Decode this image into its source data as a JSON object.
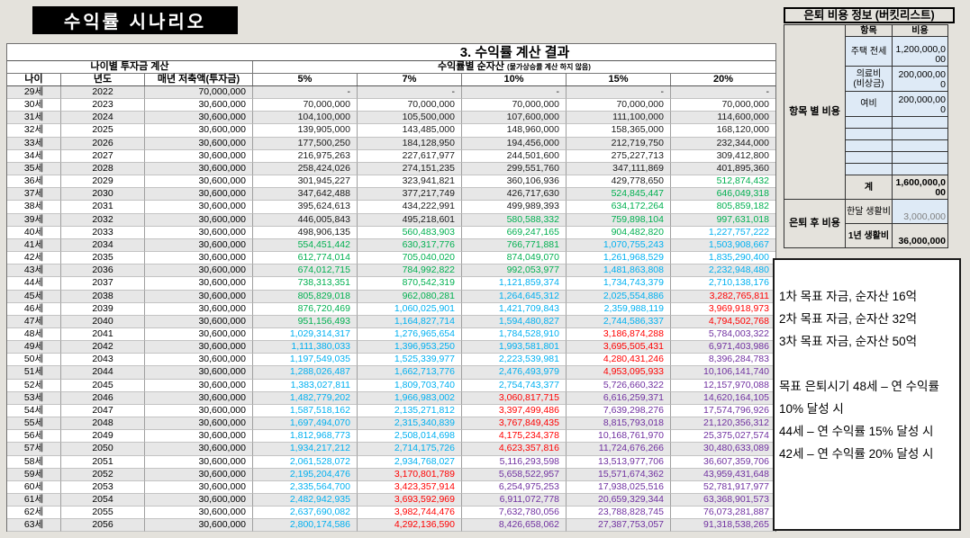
{
  "page_title": "수익률 시나리오",
  "colors": {
    "page_bg": "#E4E2DC",
    "title_bg": "#000000",
    "title_fg": "#FFFFFF",
    "stripe": "#E7E7E7",
    "panel_blue": "#DEEAF6",
    "gray_value": "#808080",
    "k": "#1A1A1A",
    "g": "#00B050",
    "b": "#00B0F0",
    "r": "#FF0000",
    "p": "#7030A0"
  },
  "main_table": {
    "title": "3. 수익률 계산 결과",
    "left_group_header": "나이별 투자금 계산",
    "right_group_header": "수익률별 순자산",
    "right_group_note": "(물가상승률 계산 하지 않음)",
    "columns": [
      "나이",
      "년도",
      "매년 저축액(투자금)",
      "5%",
      "7%",
      "10%",
      "15%",
      "20%"
    ],
    "rows": [
      [
        "29세",
        "2022",
        "70,000,000",
        [
          "-",
          "k"
        ],
        [
          "-",
          "k"
        ],
        [
          "-",
          "k"
        ],
        [
          "-",
          "k"
        ],
        [
          "-",
          "k"
        ]
      ],
      [
        "30세",
        "2023",
        "30,600,000",
        [
          "70,000,000",
          "k"
        ],
        [
          "70,000,000",
          "k"
        ],
        [
          "70,000,000",
          "k"
        ],
        [
          "70,000,000",
          "k"
        ],
        [
          "70,000,000",
          "k"
        ]
      ],
      [
        "31세",
        "2024",
        "30,600,000",
        [
          "104,100,000",
          "k"
        ],
        [
          "105,500,000",
          "k"
        ],
        [
          "107,600,000",
          "k"
        ],
        [
          "111,100,000",
          "k"
        ],
        [
          "114,600,000",
          "k"
        ]
      ],
      [
        "32세",
        "2025",
        "30,600,000",
        [
          "139,905,000",
          "k"
        ],
        [
          "143,485,000",
          "k"
        ],
        [
          "148,960,000",
          "k"
        ],
        [
          "158,365,000",
          "k"
        ],
        [
          "168,120,000",
          "k"
        ]
      ],
      [
        "33세",
        "2026",
        "30,600,000",
        [
          "177,500,250",
          "k"
        ],
        [
          "184,128,950",
          "k"
        ],
        [
          "194,456,000",
          "k"
        ],
        [
          "212,719,750",
          "k"
        ],
        [
          "232,344,000",
          "k"
        ]
      ],
      [
        "34세",
        "2027",
        "30,600,000",
        [
          "216,975,263",
          "k"
        ],
        [
          "227,617,977",
          "k"
        ],
        [
          "244,501,600",
          "k"
        ],
        [
          "275,227,713",
          "k"
        ],
        [
          "309,412,800",
          "k"
        ]
      ],
      [
        "35세",
        "2028",
        "30,600,000",
        [
          "258,424,026",
          "k"
        ],
        [
          "274,151,235",
          "k"
        ],
        [
          "299,551,760",
          "k"
        ],
        [
          "347,111,869",
          "k"
        ],
        [
          "401,895,360",
          "k"
        ]
      ],
      [
        "36세",
        "2029",
        "30,600,000",
        [
          "301,945,227",
          "k"
        ],
        [
          "323,941,821",
          "k"
        ],
        [
          "360,106,936",
          "k"
        ],
        [
          "429,778,650",
          "k"
        ],
        [
          "512,874,432",
          "g"
        ]
      ],
      [
        "37세",
        "2030",
        "30,600,000",
        [
          "347,642,488",
          "k"
        ],
        [
          "377,217,749",
          "k"
        ],
        [
          "426,717,630",
          "k"
        ],
        [
          "524,845,447",
          "g"
        ],
        [
          "646,049,318",
          "g"
        ]
      ],
      [
        "38세",
        "2031",
        "30,600,000",
        [
          "395,624,613",
          "k"
        ],
        [
          "434,222,991",
          "k"
        ],
        [
          "499,989,393",
          "k"
        ],
        [
          "634,172,264",
          "g"
        ],
        [
          "805,859,182",
          "g"
        ]
      ],
      [
        "39세",
        "2032",
        "30,600,000",
        [
          "446,005,843",
          "k"
        ],
        [
          "495,218,601",
          "k"
        ],
        [
          "580,588,332",
          "g"
        ],
        [
          "759,898,104",
          "g"
        ],
        [
          "997,631,018",
          "g"
        ]
      ],
      [
        "40세",
        "2033",
        "30,600,000",
        [
          "498,906,135",
          "k"
        ],
        [
          "560,483,903",
          "g"
        ],
        [
          "669,247,165",
          "g"
        ],
        [
          "904,482,820",
          "g"
        ],
        [
          "1,227,757,222",
          "b"
        ]
      ],
      [
        "41세",
        "2034",
        "30,600,000",
        [
          "554,451,442",
          "g"
        ],
        [
          "630,317,776",
          "g"
        ],
        [
          "766,771,881",
          "g"
        ],
        [
          "1,070,755,243",
          "b"
        ],
        [
          "1,503,908,667",
          "b"
        ]
      ],
      [
        "42세",
        "2035",
        "30,600,000",
        [
          "612,774,014",
          "g"
        ],
        [
          "705,040,020",
          "g"
        ],
        [
          "874,049,070",
          "g"
        ],
        [
          "1,261,968,529",
          "b"
        ],
        [
          "1,835,290,400",
          "b"
        ]
      ],
      [
        "43세",
        "2036",
        "30,600,000",
        [
          "674,012,715",
          "g"
        ],
        [
          "784,992,822",
          "g"
        ],
        [
          "992,053,977",
          "g"
        ],
        [
          "1,481,863,808",
          "b"
        ],
        [
          "2,232,948,480",
          "b"
        ]
      ],
      [
        "44세",
        "2037",
        "30,600,000",
        [
          "738,313,351",
          "g"
        ],
        [
          "870,542,319",
          "g"
        ],
        [
          "1,121,859,374",
          "b"
        ],
        [
          "1,734,743,379",
          "b"
        ],
        [
          "2,710,138,176",
          "b"
        ]
      ],
      [
        "45세",
        "2038",
        "30,600,000",
        [
          "805,829,018",
          "g"
        ],
        [
          "962,080,281",
          "g"
        ],
        [
          "1,264,645,312",
          "b"
        ],
        [
          "2,025,554,886",
          "b"
        ],
        [
          "3,282,765,811",
          "r"
        ]
      ],
      [
        "46세",
        "2039",
        "30,600,000",
        [
          "876,720,469",
          "g"
        ],
        [
          "1,060,025,901",
          "b"
        ],
        [
          "1,421,709,843",
          "b"
        ],
        [
          "2,359,988,119",
          "b"
        ],
        [
          "3,969,918,973",
          "r"
        ]
      ],
      [
        "47세",
        "2040",
        "30,600,000",
        [
          "951,156,493",
          "g"
        ],
        [
          "1,164,827,714",
          "b"
        ],
        [
          "1,594,480,827",
          "b"
        ],
        [
          "2,744,586,337",
          "b"
        ],
        [
          "4,794,502,768",
          "r"
        ]
      ],
      [
        "48세",
        "2041",
        "30,600,000",
        [
          "1,029,314,317",
          "b"
        ],
        [
          "1,276,965,654",
          "b"
        ],
        [
          "1,784,528,910",
          "b"
        ],
        [
          "3,186,874,288",
          "r"
        ],
        [
          "5,784,003,322",
          "p"
        ]
      ],
      [
        "49세",
        "2042",
        "30,600,000",
        [
          "1,111,380,033",
          "b"
        ],
        [
          "1,396,953,250",
          "b"
        ],
        [
          "1,993,581,801",
          "b"
        ],
        [
          "3,695,505,431",
          "r"
        ],
        [
          "6,971,403,986",
          "p"
        ]
      ],
      [
        "50세",
        "2043",
        "30,600,000",
        [
          "1,197,549,035",
          "b"
        ],
        [
          "1,525,339,977",
          "b"
        ],
        [
          "2,223,539,981",
          "b"
        ],
        [
          "4,280,431,246",
          "r"
        ],
        [
          "8,396,284,783",
          "p"
        ]
      ],
      [
        "51세",
        "2044",
        "30,600,000",
        [
          "1,288,026,487",
          "b"
        ],
        [
          "1,662,713,776",
          "b"
        ],
        [
          "2,476,493,979",
          "b"
        ],
        [
          "4,953,095,933",
          "r"
        ],
        [
          "10,106,141,740",
          "p"
        ]
      ],
      [
        "52세",
        "2045",
        "30,600,000",
        [
          "1,383,027,811",
          "b"
        ],
        [
          "1,809,703,740",
          "b"
        ],
        [
          "2,754,743,377",
          "b"
        ],
        [
          "5,726,660,322",
          "p"
        ],
        [
          "12,157,970,088",
          "p"
        ]
      ],
      [
        "53세",
        "2046",
        "30,600,000",
        [
          "1,482,779,202",
          "b"
        ],
        [
          "1,966,983,002",
          "b"
        ],
        [
          "3,060,817,715",
          "r"
        ],
        [
          "6,616,259,371",
          "p"
        ],
        [
          "14,620,164,105",
          "p"
        ]
      ],
      [
        "54세",
        "2047",
        "30,600,000",
        [
          "1,587,518,162",
          "b"
        ],
        [
          "2,135,271,812",
          "b"
        ],
        [
          "3,397,499,486",
          "r"
        ],
        [
          "7,639,298,276",
          "p"
        ],
        [
          "17,574,796,926",
          "p"
        ]
      ],
      [
        "55세",
        "2048",
        "30,600,000",
        [
          "1,697,494,070",
          "b"
        ],
        [
          "2,315,340,839",
          "b"
        ],
        [
          "3,767,849,435",
          "r"
        ],
        [
          "8,815,793,018",
          "p"
        ],
        [
          "21,120,356,312",
          "p"
        ]
      ],
      [
        "56세",
        "2049",
        "30,600,000",
        [
          "1,812,968,773",
          "b"
        ],
        [
          "2,508,014,698",
          "b"
        ],
        [
          "4,175,234,378",
          "r"
        ],
        [
          "10,168,761,970",
          "p"
        ],
        [
          "25,375,027,574",
          "p"
        ]
      ],
      [
        "57세",
        "2050",
        "30,600,000",
        [
          "1,934,217,212",
          "b"
        ],
        [
          "2,714,175,726",
          "b"
        ],
        [
          "4,623,357,816",
          "r"
        ],
        [
          "11,724,676,266",
          "p"
        ],
        [
          "30,480,633,089",
          "p"
        ]
      ],
      [
        "58세",
        "2051",
        "30,600,000",
        [
          "2,061,528,072",
          "b"
        ],
        [
          "2,934,768,027",
          "b"
        ],
        [
          "5,116,293,598",
          "p"
        ],
        [
          "13,513,977,706",
          "p"
        ],
        [
          "36,607,359,706",
          "p"
        ]
      ],
      [
        "59세",
        "2052",
        "30,600,000",
        [
          "2,195,204,476",
          "b"
        ],
        [
          "3,170,801,789",
          "r"
        ],
        [
          "5,658,522,957",
          "p"
        ],
        [
          "15,571,674,362",
          "p"
        ],
        [
          "43,959,431,648",
          "p"
        ]
      ],
      [
        "60세",
        "2053",
        "30,600,000",
        [
          "2,335,564,700",
          "b"
        ],
        [
          "3,423,357,914",
          "r"
        ],
        [
          "6,254,975,253",
          "p"
        ],
        [
          "17,938,025,516",
          "p"
        ],
        [
          "52,781,917,977",
          "p"
        ]
      ],
      [
        "61세",
        "2054",
        "30,600,000",
        [
          "2,482,942,935",
          "b"
        ],
        [
          "3,693,592,969",
          "r"
        ],
        [
          "6,911,072,778",
          "p"
        ],
        [
          "20,659,329,344",
          "p"
        ],
        [
          "63,368,901,573",
          "p"
        ]
      ],
      [
        "62세",
        "2055",
        "30,600,000",
        [
          "2,637,690,082",
          "b"
        ],
        [
          "3,982,744,476",
          "r"
        ],
        [
          "7,632,780,056",
          "p"
        ],
        [
          "23,788,828,745",
          "p"
        ],
        [
          "76,073,281,887",
          "p"
        ]
      ],
      [
        "63세",
        "2056",
        "30,600,000",
        [
          "2,800,174,586",
          "b"
        ],
        [
          "4,292,136,590",
          "r"
        ],
        [
          "8,426,658,062",
          "p"
        ],
        [
          "27,387,753,057",
          "p"
        ],
        [
          "91,318,538,265",
          "p"
        ]
      ]
    ]
  },
  "retirement_panel": {
    "title": "은퇴 비용 정보 (버킷리스트)",
    "col_headers": [
      "항목",
      "비용"
    ],
    "group1_label": "항목 별 비용",
    "group2_label": "은퇴 후 비용",
    "items": [
      [
        "주택 전세",
        "1,200,000,000"
      ],
      [
        "의료비(비상금)",
        "200,000,000"
      ],
      [
        "여비",
        "200,000,000"
      ]
    ],
    "empty_row_count": 5,
    "total_label": "계",
    "total_value": "1,600,000,000",
    "monthly_label": "한달 생활비",
    "monthly_value": "3,000,000",
    "yearly_label": "1년 생활비",
    "yearly_value": "36,000,000"
  },
  "notes_box": {
    "lines": [
      "1차 목표 자금, 순자산 16억",
      "2차 목표 자금, 순자산 32억",
      "3차 목표 자금, 순자산 50억",
      "",
      "목표 은퇴시기 48세 – 연 수익률 10% 달성 시",
      "44세 – 연 수익률 15% 달성 시",
      "42세 – 연 수익률 20% 달성 시"
    ]
  }
}
